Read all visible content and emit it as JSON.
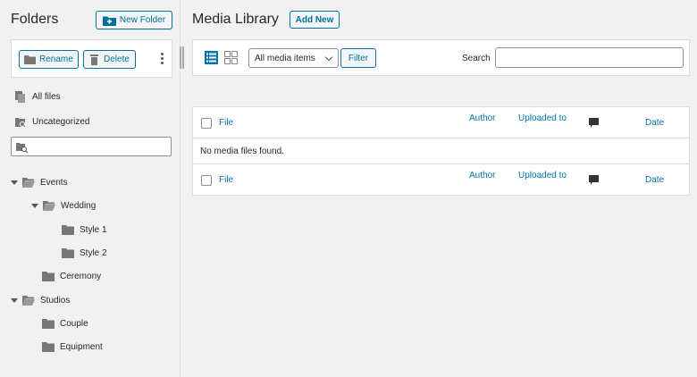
{
  "sidebar": {
    "title": "Folders",
    "new_folder_label": "New Folder",
    "rename_label": "Rename",
    "delete_label": "Delete",
    "all_files_label": "All files",
    "uncategorized_label": "Uncategorized",
    "search_placeholder": "",
    "tree": {
      "events": "Events",
      "wedding": "Wedding",
      "style1": "Style 1",
      "style2": "Style 2",
      "ceremony": "Ceremony",
      "studios": "Studios",
      "couple": "Couple",
      "equipment": "Equipment"
    }
  },
  "main": {
    "title": "Media Library",
    "add_new_label": "Add New",
    "filter_select_value": "All media items",
    "filter_button_label": "Filter",
    "search_label": "Search",
    "search_value": "",
    "columns": {
      "file": "File",
      "author": "Author",
      "uploaded_to": "Uploaded to",
      "date": "Date"
    },
    "empty_message": "No media files found."
  },
  "colors": {
    "accent": "#0071a1",
    "link": "#0073aa",
    "background": "#f1f1f1"
  },
  "icons": [
    "new-folder-icon",
    "rename-folder-icon",
    "trash-icon",
    "kebab-menu-icon",
    "all-files-icon",
    "uncategorized-icon",
    "search-folder-icon",
    "folder-icon",
    "list-view-icon",
    "grid-view-icon",
    "comment-icon"
  ]
}
